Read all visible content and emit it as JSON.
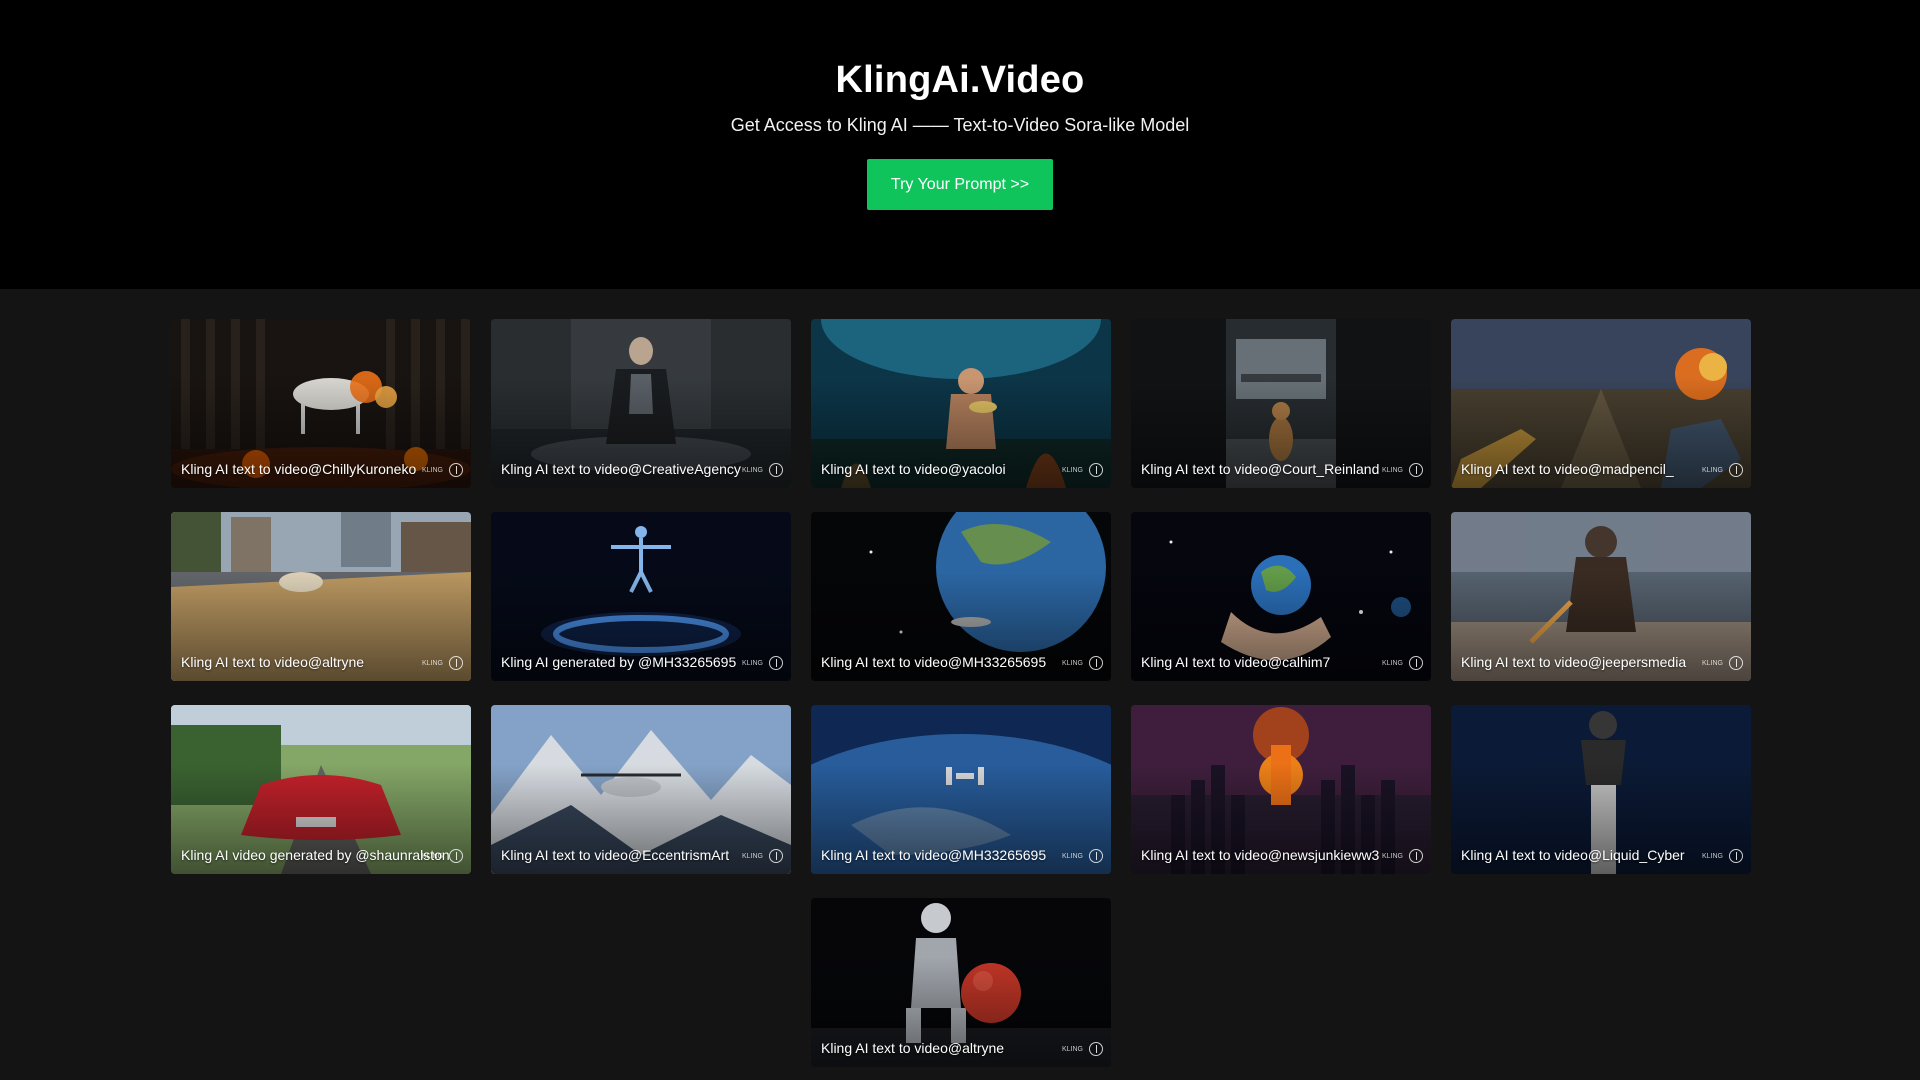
{
  "hero": {
    "title": "KlingAi.Video",
    "subtitle": "Get Access to Kling AI —— Text-to-Video Sora-like Model",
    "cta_label": "Try Your Prompt >>"
  },
  "colors": {
    "hero_bg": "#000000",
    "page_bg": "#141414",
    "cta": "#10c45c"
  },
  "watermark_text": "KLING",
  "videos": [
    {
      "caption": "Kling AI text to video@ChillyKuroneko",
      "scene": "fire-horse-in-dark-forest"
    },
    {
      "caption": "Kling AI text to video@CreativeAgency",
      "scene": "armored-woman-in-flooded-factory"
    },
    {
      "caption": "Kling AI text to video@yacoloi",
      "scene": "man-eating-noodles-underwater"
    },
    {
      "caption": "Kling AI text to video@Court_Reinland",
      "scene": "dog-walking-in-office"
    },
    {
      "caption": "Kling AI text to video@madpencil_",
      "scene": "first-person-shooter-explosion"
    },
    {
      "caption": "Kling AI text to video@altryne",
      "scene": "giant-bread-on-city-street"
    },
    {
      "caption": "Kling AI generated by @MH33265695",
      "scene": "figure-above-glowing-ring"
    },
    {
      "caption": "Kling AI text to video@MH33265695",
      "scene": "earth-from-space"
    },
    {
      "caption": "Kling AI text to video@calhim7",
      "scene": "hand-holding-globe-in-space"
    },
    {
      "caption": "Kling AI text to video@jeepersmedia",
      "scene": "wolf-warrior-on-beach"
    },
    {
      "caption": "Kling AI video generated by @shaunralston",
      "scene": "red-car-on-country-road"
    },
    {
      "caption": "Kling AI text to video@EccentrismArt",
      "scene": "helicopter-over-snowy-mountains"
    },
    {
      "caption": "Kling AI text to video@MH33265695",
      "scene": "space-station-over-earth"
    },
    {
      "caption": "Kling AI text to video@newsjunkieww3",
      "scene": "city-explosion-at-night"
    },
    {
      "caption": "Kling AI text to video@Liquid_Cyber",
      "scene": "gorilla-riding-rocket"
    },
    {
      "caption": "Kling AI text to video@altryne",
      "scene": "robot-with-red-apple"
    }
  ]
}
